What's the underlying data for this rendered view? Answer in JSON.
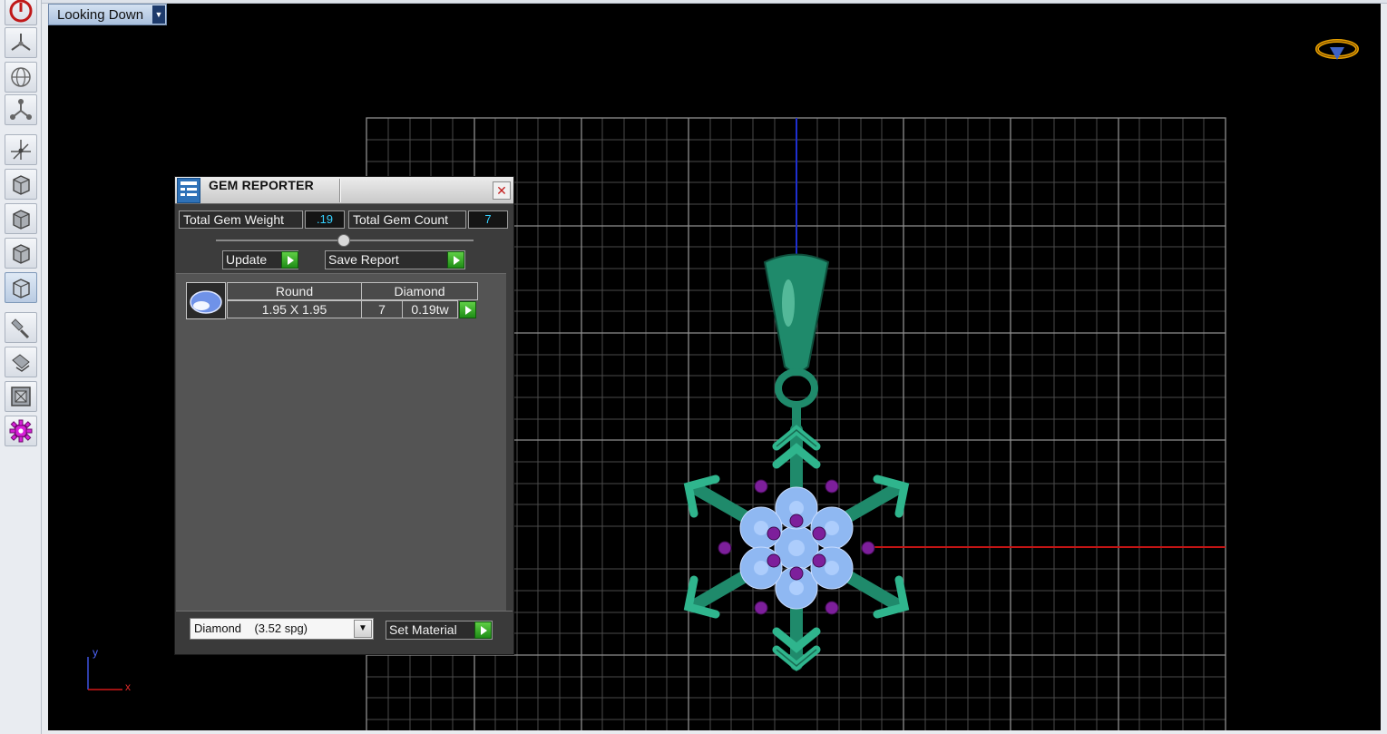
{
  "viewport": {
    "view_mode": "Looking Down",
    "axis": {
      "y_label": "y",
      "x_label": "x"
    }
  },
  "toolbar": {
    "tools": [
      "power-icon",
      "navigate-icon",
      "globe-icon",
      "pivot-icon",
      "move-axes-icon",
      "cube-front-icon",
      "cube-side-icon",
      "cube-top-icon",
      "cube-perspective-icon",
      "paint-icon",
      "material-icon",
      "frame-icon",
      "gear-icon"
    ]
  },
  "gem_reporter": {
    "title": "GEM REPORTER",
    "close_glyph": "✕",
    "total_weight_label": "Total Gem Weight",
    "total_weight_value": ".19",
    "total_count_label": "Total Gem Count",
    "total_count_value": "7",
    "update_label": "Update",
    "save_report_label": "Save Report",
    "table": {
      "headers": [
        "Round",
        "Diamond"
      ],
      "row": {
        "size": "1.95 X 1.95",
        "count": "7",
        "weight": "0.19tw"
      }
    },
    "material_selected": "Diamond    (3.52 spg)",
    "set_material_label": "Set Material",
    "dropdown_glyph": "▼"
  },
  "colors": {
    "grid": "#6e6e6e",
    "y_axis_line": "#1e2fd0",
    "x_axis_line": "#c41414",
    "metal": "#1f8a6b",
    "gem": "#8fb8f2",
    "prong": "#7d1f9b",
    "accent_go": "#2aa51d"
  }
}
